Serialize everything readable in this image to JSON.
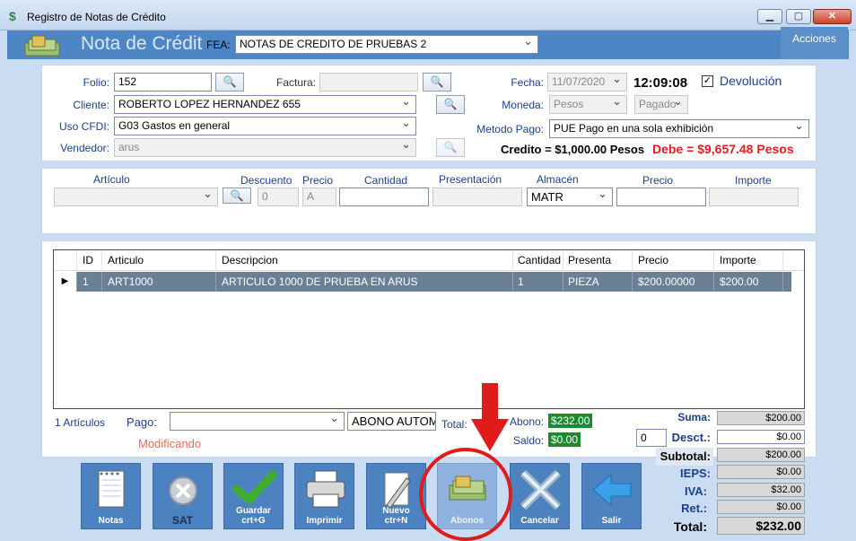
{
  "window": {
    "title": "Registro de Notas de Crédito"
  },
  "header": {
    "title": "Nota de Crédit",
    "fea_label": "FEA:",
    "fea_value": "NOTAS DE CREDITO DE PRUEBAS 2",
    "acciones": "Acciones"
  },
  "form": {
    "folio_label": "Folio:",
    "folio_value": "152",
    "factura_label": "Factura:",
    "factura_value": "",
    "fecha_label": "Fecha:",
    "fecha_value": "11/07/2020",
    "hora": "12:09:08",
    "devolucion_label": "Devolución",
    "cliente_label": "Cliente:",
    "cliente_value": "ROBERTO LOPEZ HERNANDEZ 655",
    "moneda_label": "Moneda:",
    "moneda_value": "Pesos",
    "pagado_value": "Pagado",
    "uso_label": "Uso CFDI:",
    "uso_value": "G03 Gastos en general",
    "metodo_label": "Metodo Pago:",
    "metodo_value": "PUE Pago en una sola exhibición",
    "vendedor_label": "Vendedor:",
    "vendedor_value": "arus",
    "credito_text": "Credito = $1,000.00 Pesos",
    "debe_text": "Debe = $9,657.48 Pesos"
  },
  "item_entry": {
    "articulo_label": "Artículo",
    "descuento_label": "Descuento",
    "descuento_value": "0",
    "precio_label": "Precio",
    "precio_value": "A",
    "cantidad_label": "Cantidad",
    "presentacion_label": "Presentación",
    "almacen_label": "Almacén",
    "almacen_value": "MATR",
    "precio2_label": "Precio",
    "importe_label": "Importe"
  },
  "table": {
    "columns": [
      "ID",
      "Articulo",
      "Descripcion",
      "Cantidad",
      "Presenta",
      "Precio",
      "Importe"
    ],
    "rows": [
      {
        "id": "1",
        "articulo": "ART1000",
        "descripcion": "ARTICULO 1000 DE PRUEBA EN ARUS",
        "cantidad": "1",
        "presenta": "PIEZA",
        "precio": "$200.00000",
        "importe": "$200.00"
      }
    ]
  },
  "footer": {
    "articulos_count": "1 Artículos",
    "pago_label": "Pago:",
    "abono_auto": "ABONO AUTOM",
    "total_label": "Total:",
    "status": "Modificando",
    "abono_label": "Abono:",
    "abono_value": "$232.00",
    "saldo_label": "Saldo:",
    "saldo_value": "$0.00",
    "desc_input": "0"
  },
  "totals": {
    "suma_label": "Suma:",
    "suma": "$200.00",
    "desct_label": "Desct.:",
    "desct": "$0.00",
    "subtotal_label": "Subtotal:",
    "subtotal": "$200.00",
    "ieps_label": "IEPS:",
    "ieps": "$0.00",
    "iva_label": "IVA:",
    "iva": "$32.00",
    "ret_label": "Ret.:",
    "ret": "$0.00",
    "total_label": "Total:",
    "total": "$232.00"
  },
  "toolbar": [
    {
      "label": "Notas",
      "icon": "notepad-icon"
    },
    {
      "label": "SAT",
      "icon": "sat-x-icon"
    },
    {
      "label": "Guardar\ncrt+G",
      "icon": "checkmark-icon"
    },
    {
      "label": "Imprimir",
      "icon": "printer-icon"
    },
    {
      "label": "Nuevo\nctr+N",
      "icon": "pencil-icon"
    },
    {
      "label": "Abonos",
      "icon": "money-icon"
    },
    {
      "label": "Cancelar",
      "icon": "cancel-x-icon"
    },
    {
      "label": "Salir",
      "icon": "back-arrow-icon"
    }
  ],
  "annotation": {
    "color": "#e01b1b"
  }
}
